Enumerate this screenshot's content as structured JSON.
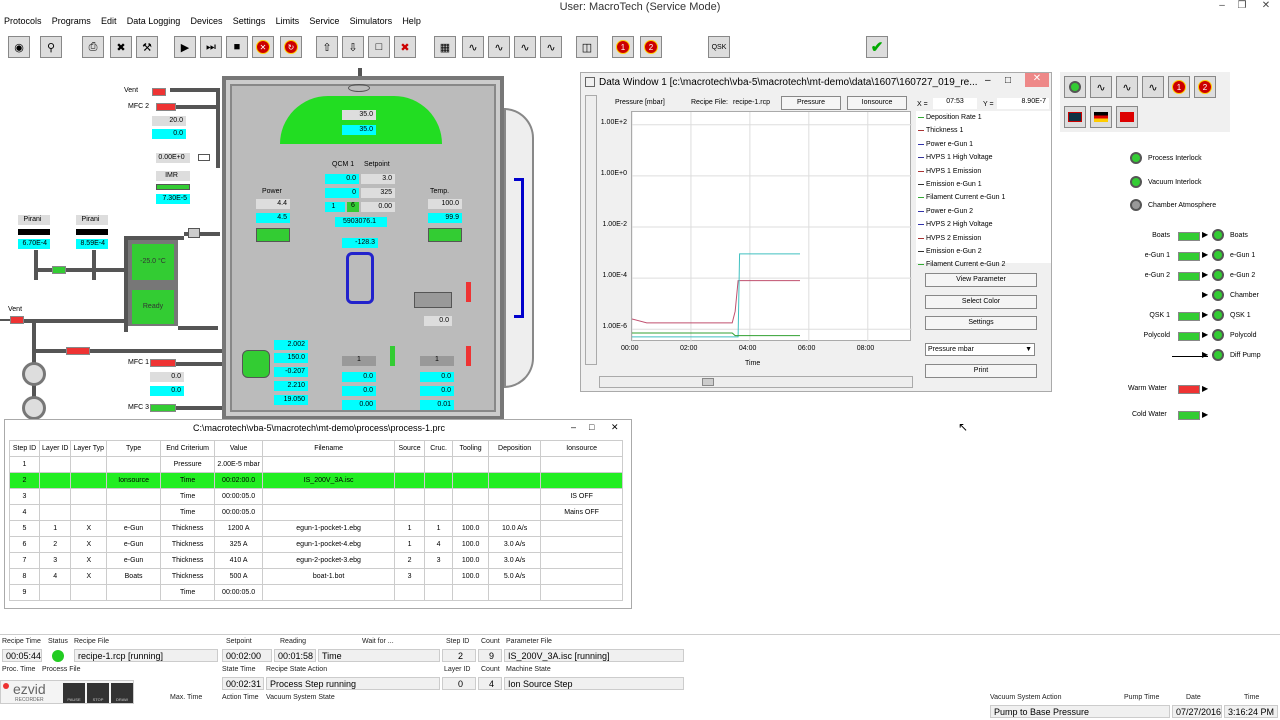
{
  "window": {
    "title": "User: MacroTech (Service Mode)"
  },
  "menu": [
    "Protocols",
    "Programs",
    "Edit",
    "Data Logging",
    "Devices",
    "Settings",
    "Limits",
    "Service",
    "Simulators",
    "Help"
  ],
  "toolbar": {
    "circle1": "1",
    "circle2": "2",
    "qsk": "QSK"
  },
  "schematic": {
    "vent_top": "Vent",
    "mfc2": "MFC 2",
    "mfc2_set": "20.0",
    "mfc2_read": "0.0",
    "gauge_val": "0.00E+0",
    "imr": "IMR",
    "imr_val": "7.30E-5",
    "pirani": "Pirani",
    "pirani1_val": "6.70E-4",
    "pirani2_val": "8.59E-4",
    "cryo_temp": "-25.0 °C",
    "cryo_status": "Ready",
    "vent_left": "Vent",
    "mfc1": "MFC 1",
    "mfc1_set": "0.0",
    "mfc1_read": "0.0",
    "mfc3": "MFC 3",
    "dome_set": "35.0",
    "dome_read": "35.0",
    "qcm_label": "QCM 1",
    "setpoint_label": "Setpoint",
    "qcm_r1": [
      "0.0",
      "3.0"
    ],
    "qcm_r2": [
      "0",
      "325"
    ],
    "qcm_r3": [
      "1",
      "6",
      "0.00"
    ],
    "qcm_freq": "5903076.1",
    "qcm_temp": "-128.3",
    "power_label": "Power",
    "power_set": "4.4",
    "power_read": "4.5",
    "temp_label": "Temp.",
    "temp_set": "100.0",
    "temp_read": "99.9",
    "shutter_val": "0.0",
    "ion_vals": [
      "2.002",
      "150.0",
      "-0.207",
      "2.210",
      "19.050"
    ],
    "pocket1": [
      "1",
      "0.0",
      "0.0",
      "0.00"
    ],
    "pocket2": [
      "1",
      "0.0",
      "0.0",
      "0.01"
    ]
  },
  "data_window": {
    "title": "Data Window 1 [c:\\macrotech\\vba-5\\macrotech\\mt-demo\\data\\1607\\160727_019_re...",
    "ylabel": "Pressure [mbar]",
    "recipe_file_label": "Recipe File:",
    "recipe_file": "recipe-1.rcp",
    "btn_pressure": "Pressure",
    "btn_ionsource": "Ionsource",
    "x_label": "X =",
    "x_val": "07:53",
    "y_label": "Y =",
    "y_val": "8.90E-7",
    "legend": [
      {
        "name": "Deposition Rate 1",
        "color": "#3a3"
      },
      {
        "name": "Thickness 1",
        "color": "#a33"
      },
      {
        "name": "Power e-Gun 1",
        "color": "#33a"
      },
      {
        "name": "HVPS 1 High Voltage",
        "color": "#339"
      },
      {
        "name": "HVPS 1 Emission",
        "color": "#a33"
      },
      {
        "name": "Emission e-Gun 1",
        "color": "#333"
      },
      {
        "name": "Filament Current e-Gun 1",
        "color": "#3a3"
      },
      {
        "name": "Power e-Gun 2",
        "color": "#33a"
      },
      {
        "name": "HVPS 2 High Voltage",
        "color": "#33a"
      },
      {
        "name": "HVPS 2 Emission",
        "color": "#a33"
      },
      {
        "name": "Emission e-Gun 2",
        "color": "#333"
      },
      {
        "name": "Filament Current e-Gun 2",
        "color": "#3a3"
      }
    ],
    "btn_view": "View Parameter",
    "btn_color": "Select Color",
    "btn_settings": "Settings",
    "select": "Pressure mbar",
    "btn_print": "Print",
    "xlabel": "Time"
  },
  "chart_data": {
    "type": "line",
    "title": "",
    "xlabel": "Time",
    "ylabel": "Pressure [mbar]",
    "x_ticks": [
      "00:00",
      "02:00",
      "04:00",
      "06:00",
      "08:00"
    ],
    "y_ticks": [
      "1.00E+2",
      "1.00E+0",
      "1.00E-2",
      "1.00E-4",
      "1.00E-6"
    ],
    "xlim": [
      0,
      9.5
    ],
    "ylim_log10": [
      -6.5,
      2.5
    ],
    "series": [
      {
        "color": "#c0506f",
        "x": [
          0,
          0.5,
          3.4,
          3.5,
          3.6,
          5.7
        ],
        "y": [
          -5.6,
          -5.75,
          -5.75,
          -5.3,
          -4.1,
          -4.1
        ]
      },
      {
        "color": "#40c0c0",
        "x": [
          0,
          3.6,
          3.65,
          5.7
        ],
        "y": [
          -6.3,
          -6.3,
          -3.05,
          -3.05
        ]
      },
      {
        "color": "#30a030",
        "x": [
          0,
          3.4,
          3.5,
          5.7
        ],
        "y": [
          -6.15,
          -6.15,
          -6.25,
          -6.25
        ]
      }
    ]
  },
  "recipe_window": {
    "title": "C:\\macrotech\\vba-5\\macrotech\\mt-demo\\process\\process-1.prc",
    "headers": [
      "Step ID",
      "Layer ID",
      "Layer Typ",
      "Type",
      "End Criterium",
      "Value",
      "Filename",
      "Source",
      "Cruc.",
      "Tooling",
      "Deposition",
      "Ionsource"
    ],
    "rows": [
      [
        "1",
        "",
        "",
        "",
        "Pressure",
        "2.00E-5 mbar",
        "",
        "",
        "",
        "",
        "",
        ""
      ],
      [
        "2",
        "",
        "",
        "Ionsource",
        "Time",
        "00:02:00.0",
        "IS_200V_3A.isc",
        "",
        "",
        "",
        "",
        ""
      ],
      [
        "3",
        "",
        "",
        "",
        "Time",
        "00:00:05.0",
        "",
        "",
        "",
        "",
        "",
        "IS OFF"
      ],
      [
        "4",
        "",
        "",
        "",
        "Time",
        "00:00:05.0",
        "",
        "",
        "",
        "",
        "",
        "Mains OFF"
      ],
      [
        "5",
        "1",
        "X",
        "e-Gun",
        "Thickness",
        "1200 A",
        "egun-1-pocket-1.ebg",
        "1",
        "1",
        "100.0",
        "10.0 A/s",
        ""
      ],
      [
        "6",
        "2",
        "X",
        "e-Gun",
        "Thickness",
        "325 A",
        "egun-1-pocket-4.ebg",
        "1",
        "4",
        "100.0",
        "3.0 A/s",
        ""
      ],
      [
        "7",
        "3",
        "X",
        "e-Gun",
        "Thickness",
        "410 A",
        "egun-2-pocket-3.ebg",
        "2",
        "3",
        "100.0",
        "3.0 A/s",
        ""
      ],
      [
        "8",
        "4",
        "X",
        "Boats",
        "Thickness",
        "500 A",
        "boat-1.bot",
        "3",
        "",
        "100.0",
        "5.0 A/s",
        ""
      ],
      [
        "9",
        "",
        "",
        "",
        "Time",
        "00:00:05.0",
        "",
        "",
        "",
        "",
        "",
        ""
      ]
    ]
  },
  "indicators": {
    "process_interlock": "Process Interlock",
    "vacuum_interlock": "Vacuum Interlock",
    "chamber_atmosphere": "Chamber Atmosphere"
  },
  "flow": {
    "rows": [
      {
        "left": "Boats",
        "right": "Boats"
      },
      {
        "left": "e-Gun 1",
        "right": "e-Gun 1"
      },
      {
        "left": "e-Gun 2",
        "right": "e-Gun 2"
      },
      {
        "left": "",
        "right": "Chamber"
      },
      {
        "left": "QSK 1",
        "right": "QSK 1"
      },
      {
        "left": "Polycold",
        "right": "Polycold"
      },
      {
        "left": "",
        "right": "Diff Pump"
      }
    ],
    "warm_water": "Warm Water",
    "cold_water": "Cold Water"
  },
  "status": {
    "h_recipe_time": "Recipe Time",
    "h_status": "Status",
    "h_recipe_file": "Recipe File",
    "h_setpoint": "Setpoint",
    "h_reading": "Reading",
    "h_wait": "Wait for ...",
    "h_step_id": "Step ID",
    "h_count": "Count",
    "h_param_file": "Parameter File",
    "recipe_time": "00:05:44",
    "recipe_file": "recipe-1.rcp [running]",
    "setpoint": "00:02:00",
    "reading": "00:01:58",
    "wait": "Time",
    "step_id": "2",
    "count": "9",
    "param_file": "IS_200V_3A.isc [running]",
    "h_proc_time": "Proc. Time",
    "h_process_file": "Process File",
    "h_state_time": "State Time",
    "h_recipe_state_action": "Recipe State Action",
    "h_layer_id": "Layer ID",
    "h_count2": "Count",
    "h_machine_state": "Machine State",
    "state_time": "00:02:31",
    "recipe_state_action": "Process Step running",
    "layer_id": "0",
    "count2": "4",
    "machine_state": "Ion Source Step",
    "h_max_time": "Max. Time",
    "h_action_time": "Action Time",
    "h_vac_state": "Vacuum System State",
    "h_vac_action": "Vacuum System Action",
    "h_pump_time": "Pump Time",
    "h_date": "Date",
    "h_time": "Time",
    "vac_action": "Pump to Base Pressure",
    "date": "07/27/2016",
    "time": "3:16:24 PM"
  },
  "watermark": {
    "brand": "ezvid",
    "sub": "RECORDER",
    "pause": "PAUSE",
    "stop": "STOP",
    "draw": "DRAW"
  }
}
